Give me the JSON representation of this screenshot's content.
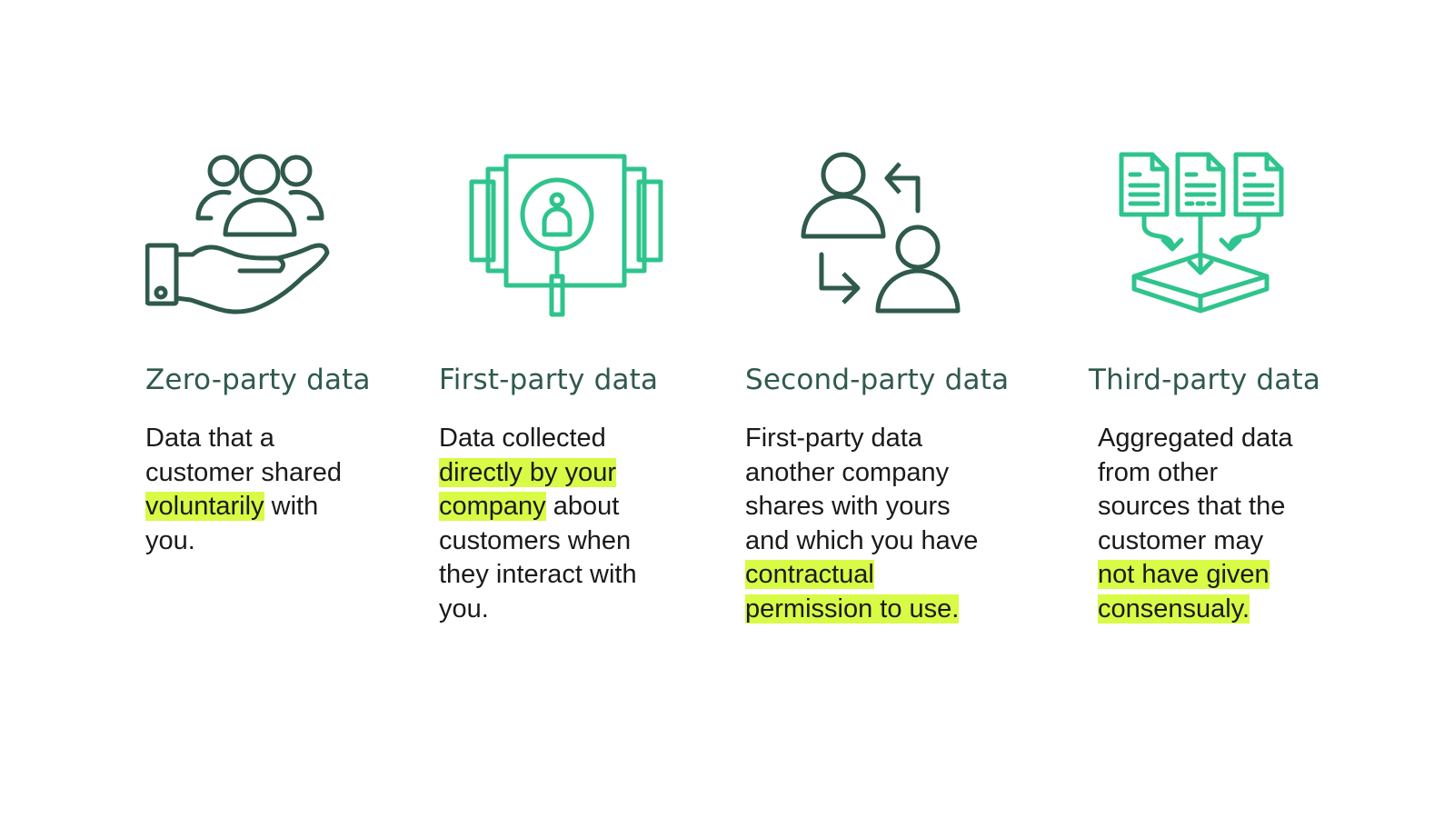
{
  "colors": {
    "dark_green": "#2f5a4b",
    "bright_green": "#2fc48d",
    "highlight": "#d8fb46",
    "body_text": "#1a1a1a"
  },
  "columns": [
    {
      "icon": "hand-holding-people-icon",
      "icon_color": "#2f5a4b",
      "heading": "Zero-party data",
      "lines": [
        {
          "pre": "Data that a",
          "hl": "",
          "post": ""
        },
        {
          "pre": "customer shared",
          "hl": "",
          "post": ""
        },
        {
          "pre": "",
          "hl": "voluntarily",
          "post": " with"
        },
        {
          "pre": "you.",
          "hl": "",
          "post": ""
        }
      ]
    },
    {
      "icon": "person-search-document-icon",
      "icon_color": "#2fc48d",
      "heading": "First-party data",
      "lines": [
        {
          "pre": "Data collected",
          "hl": "",
          "post": ""
        },
        {
          "pre": "",
          "hl": "directly by your ",
          "post": ""
        },
        {
          "pre": "",
          "hl": "company",
          "post": " about"
        },
        {
          "pre": "customers when",
          "hl": "",
          "post": ""
        },
        {
          "pre": "they interact with",
          "hl": "",
          "post": ""
        },
        {
          "pre": "you.",
          "hl": "",
          "post": ""
        }
      ]
    },
    {
      "icon": "people-exchange-icon",
      "icon_color": "#2f5a4b",
      "heading": "Second-party data",
      "lines": [
        {
          "pre": "First-party data",
          "hl": "",
          "post": ""
        },
        {
          "pre": "another company",
          "hl": "",
          "post": ""
        },
        {
          "pre": "shares with yours",
          "hl": "",
          "post": ""
        },
        {
          "pre": "and which you have",
          "hl": "",
          "post": ""
        },
        {
          "pre": "",
          "hl": "contractual ",
          "post": ""
        },
        {
          "pre": "",
          "hl": "permission to use.",
          "post": ""
        }
      ]
    },
    {
      "icon": "documents-aggregate-icon",
      "icon_color": "#2fc48d",
      "heading": "Third-party data",
      "lines": [
        {
          "pre": "Aggregated data",
          "hl": "",
          "post": ""
        },
        {
          "pre": "from other",
          "hl": "",
          "post": ""
        },
        {
          "pre": "sources that the",
          "hl": "",
          "post": ""
        },
        {
          "pre": "customer may",
          "hl": "",
          "post": ""
        },
        {
          "pre": "",
          "hl": "not have given",
          "post": ""
        },
        {
          "pre": "",
          "hl": "consensualy.",
          "post": ""
        }
      ]
    }
  ]
}
